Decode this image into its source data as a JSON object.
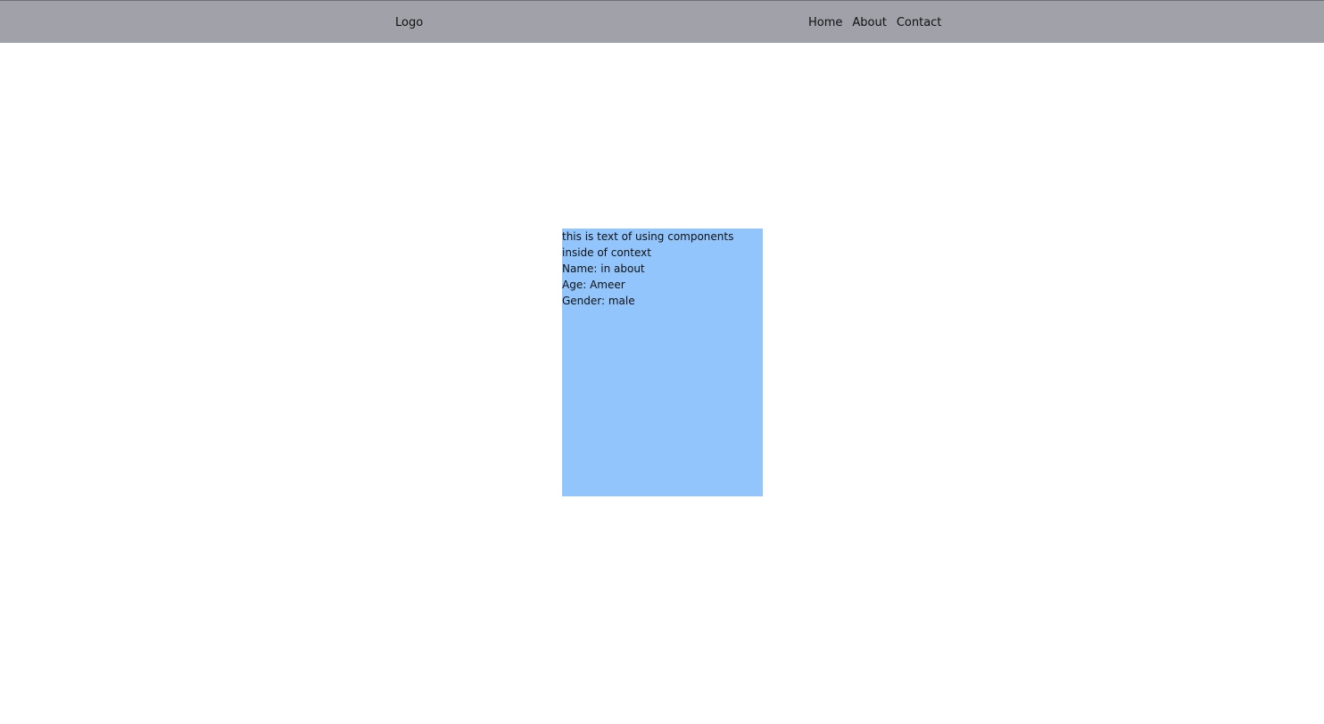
{
  "navbar": {
    "logo": "Logo",
    "links": [
      "Home",
      "About",
      "Contact"
    ]
  },
  "card": {
    "intro": "this is text of using components inside of context",
    "name_line": "Name: in about",
    "age_line": "Age: Ameer",
    "gender_line": "Gender: male"
  },
  "colors": {
    "navbar_background": "#a1a1a9",
    "card_background": "#93c5fd",
    "page_background": "#ffffff"
  }
}
